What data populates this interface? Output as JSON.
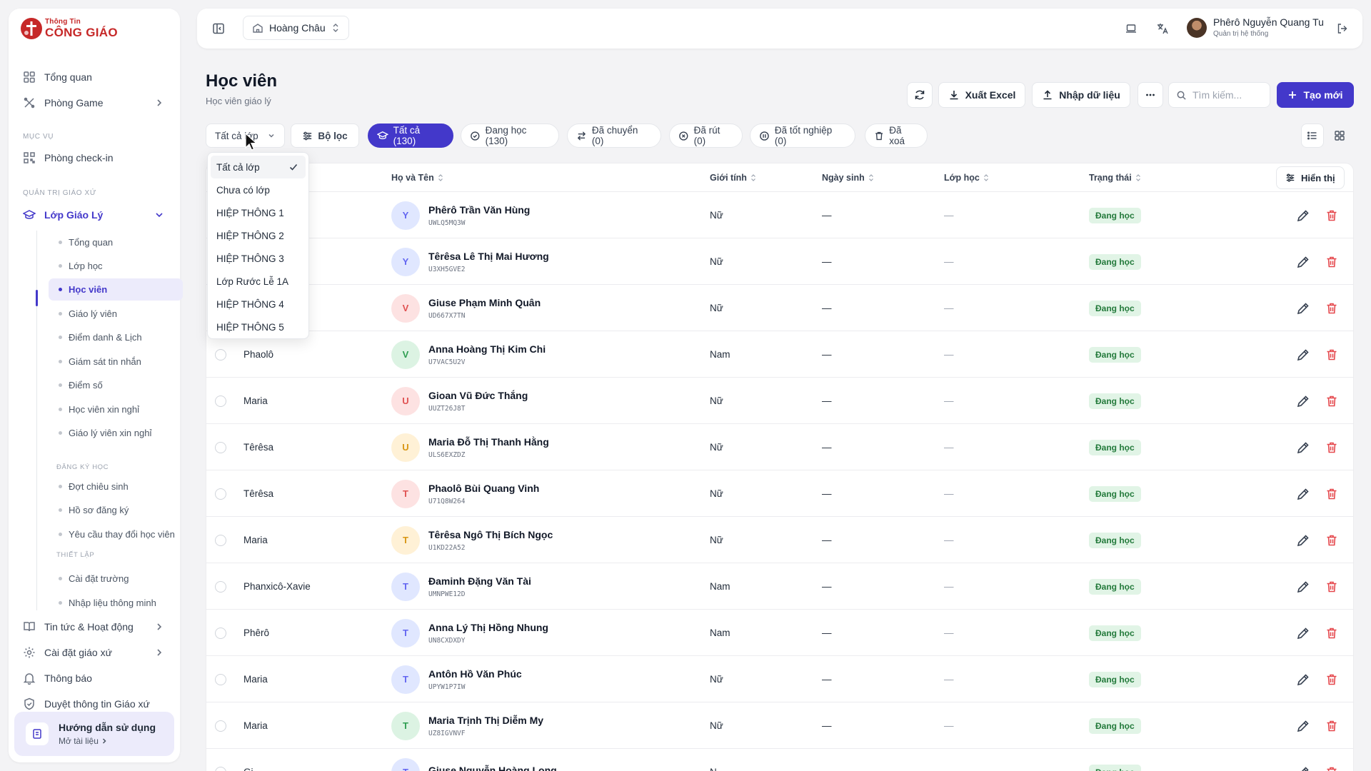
{
  "brand": {
    "top": "Thông Tin",
    "bottom": "CÔNG GIÁO"
  },
  "sidebar": {
    "main": [
      {
        "label": "Tổng quan",
        "icon": "grid-icon"
      },
      {
        "label": "Phòng Game",
        "icon": "gamepad-icon"
      }
    ],
    "section_service": "MỤC VỤ",
    "service": [
      {
        "label": "Phòng check-in",
        "icon": "qr-icon"
      }
    ],
    "section_admin": "QUẢN TRỊ GIÁO XỨ",
    "catechism": {
      "label": "Lớp Giáo Lý",
      "icon": "graduation-cap-icon"
    },
    "catechism_items": [
      "Tổng quan",
      "Lớp học",
      "Học viên",
      "Giáo lý viên",
      "Điểm danh & Lịch",
      "Giám sát tin nhắn",
      "Điểm số",
      "Học viên xin nghỉ",
      "Giáo lý viên xin nghỉ"
    ],
    "section_register": "ĐĂNG KÝ HỌC",
    "register_items": [
      "Đợt chiêu sinh",
      "Hồ sơ đăng ký",
      "Yêu cầu thay đổi học viên"
    ],
    "section_setup": "THIẾT LẬP",
    "setup_items": [
      "Cài đặt trường",
      "Nhập liệu thông minh"
    ],
    "bottom": [
      {
        "label": "Tin tức & Hoạt động",
        "icon": "book-icon"
      },
      {
        "label": "Cài đặt giáo xứ",
        "icon": "gear-icon"
      },
      {
        "label": "Thông báo",
        "icon": "bell-icon"
      },
      {
        "label": "Duyệt thông tin Giáo xứ",
        "icon": "shield-icon"
      }
    ],
    "guide": {
      "title": "Hướng dẫn sử dụng",
      "link": "Mở tài liệu"
    }
  },
  "header": {
    "parish": "Hoàng Châu",
    "user_name": "Phêrô Nguyễn Quang Tu",
    "user_role": "Quản trị hệ thống"
  },
  "page": {
    "title": "Học viên",
    "subtitle": "Học viên giáo lý",
    "export": "Xuất Excel",
    "import": "Nhập dữ liệu",
    "search_placeholder": "Tìm kiếm...",
    "create": "Tạo mới"
  },
  "filters": {
    "class_select": "Tất cả lớp",
    "filter": "Bộ lọc",
    "tabs": [
      "Tất cả (130)",
      "Đang học (130)",
      "Đã chuyển (0)",
      "Đã rút (0)",
      "Đã tốt nghiệp (0)",
      "Đã xoá"
    ]
  },
  "dropdown": {
    "selected": "Tất cả lớp",
    "options": [
      "Tất cả lớp",
      "Chưa có lớp",
      "HIỆP THÔNG 1",
      "HIỆP THÔNG 2",
      "HIỆP THÔNG 3",
      "Lớp Rước Lễ 1A",
      "HIỆP THÔNG 4",
      "HIỆP THÔNG 5"
    ]
  },
  "table": {
    "columns": {
      "name": "Họ và Tên",
      "gender": "Giới tính",
      "dob": "Ngày sinh",
      "class": "Lớp học",
      "status": "Trạng thái",
      "display": "Hiển thị"
    },
    "rows": [
      {
        "saint": "",
        "initial": "Y",
        "color": "Y",
        "name": "Phêrô Trần Văn Hùng",
        "code": "UWLQ5MQ3W",
        "gender": "Nữ",
        "dob": "—",
        "class": "—",
        "status": "Đang học"
      },
      {
        "saint": "",
        "initial": "Y",
        "color": "Y",
        "name": "Têrêsa Lê Thị Mai Hương",
        "code": "U3XH5GVE2",
        "gender": "Nữ",
        "dob": "—",
        "class": "—",
        "status": "Đang học"
      },
      {
        "saint": "",
        "initial": "V",
        "color": "V",
        "name": "Giuse Phạm Minh Quân",
        "code": "UD667X7TN",
        "gender": "Nữ",
        "dob": "—",
        "class": "—",
        "status": "Đang học"
      },
      {
        "saint": "Phaolô",
        "initial": "V",
        "color": "VG",
        "name": "Anna Hoàng Thị Kim Chi",
        "code": "U7VAC5U2V",
        "gender": "Nam",
        "dob": "—",
        "class": "—",
        "status": "Đang học"
      },
      {
        "saint": "Maria",
        "initial": "U",
        "color": "U",
        "name": "Gioan Vũ Đức Thắng",
        "code": "UUZT26J8T",
        "gender": "Nữ",
        "dob": "—",
        "class": "—",
        "status": "Đang học"
      },
      {
        "saint": "Têrêsa",
        "initial": "U",
        "color": "UO",
        "name": "Maria Đỗ Thị Thanh Hằng",
        "code": "ULS6EXZDZ",
        "gender": "Nữ",
        "dob": "—",
        "class": "—",
        "status": "Đang học"
      },
      {
        "saint": "Têrêsa",
        "initial": "T",
        "color": "TR",
        "name": "Phaolô Bùi Quang Vinh",
        "code": "U71Q8W264",
        "gender": "Nữ",
        "dob": "—",
        "class": "—",
        "status": "Đang học"
      },
      {
        "saint": "Maria",
        "initial": "T",
        "color": "TO",
        "name": "Têrêsa Ngô Thị Bích Ngọc",
        "code": "U1KD22A52",
        "gender": "Nữ",
        "dob": "—",
        "class": "—",
        "status": "Đang học"
      },
      {
        "saint": "Phanxicô-Xavie",
        "initial": "T",
        "color": "T",
        "name": "Đaminh Đặng Văn Tài",
        "code": "UMNPWE12D",
        "gender": "Nam",
        "dob": "—",
        "class": "—",
        "status": "Đang học"
      },
      {
        "saint": "Phêrô",
        "initial": "T",
        "color": "T",
        "name": "Anna Lý Thị Hồng Nhung",
        "code": "UN8CXDXDY",
        "gender": "Nam",
        "dob": "—",
        "class": "—",
        "status": "Đang học"
      },
      {
        "saint": "Maria",
        "initial": "T",
        "color": "T",
        "name": "Antôn Hồ Văn Phúc",
        "code": "UPYW1P7IW",
        "gender": "Nữ",
        "dob": "—",
        "class": "—",
        "status": "Đang học"
      },
      {
        "saint": "Maria",
        "initial": "T",
        "color": "TG",
        "name": "Maria Trịnh Thị Diễm My",
        "code": "UZ8IGVNVF",
        "gender": "Nữ",
        "dob": "—",
        "class": "—",
        "status": "Đang học"
      },
      {
        "saint": "Gi",
        "initial": "T",
        "color": "T",
        "name": "Giuse Nguyễn Hoàng Long",
        "code": "",
        "gender": "N",
        "dob": "—",
        "class": "—",
        "status": "Đang học"
      }
    ]
  },
  "colors": {
    "accent": "#4338ca",
    "danger": "#e5484d",
    "success_bg": "#e1f4e6",
    "brand_red": "#c62828"
  }
}
